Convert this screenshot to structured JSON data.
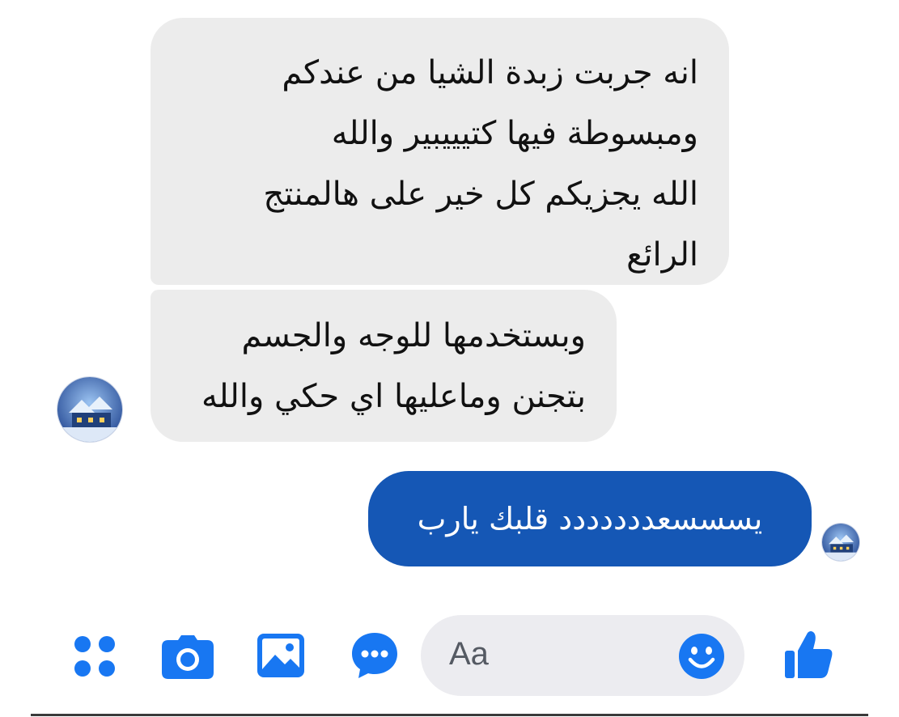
{
  "conversation": {
    "received": [
      {
        "lines": [
          "انه جربت زبدة الشيا من عندكم",
          "ومبسوطة فيها كتيييبير والله",
          "الله يجزيكم كل خير على هالمنتج",
          "الرائع"
        ]
      },
      {
        "lines": [
          "وبستخدمها للوجه والجسم",
          "بتجنن وماعليها اي حكي والله"
        ]
      }
    ],
    "sent": {
      "text": "يسسسعددددددد قلبك يارب"
    }
  },
  "composer": {
    "placeholder": "Aa"
  },
  "icons": {
    "apps": "apps-grid-icon",
    "camera": "camera-icon",
    "gallery": "image-icon",
    "chat": "chat-bubble-icon",
    "emoji": "emoji-icon",
    "like": "thumbs-up-icon"
  },
  "colors": {
    "accent": "#1877f2",
    "sent_bubble": "#1557b5",
    "received_bubble": "#ececec"
  }
}
